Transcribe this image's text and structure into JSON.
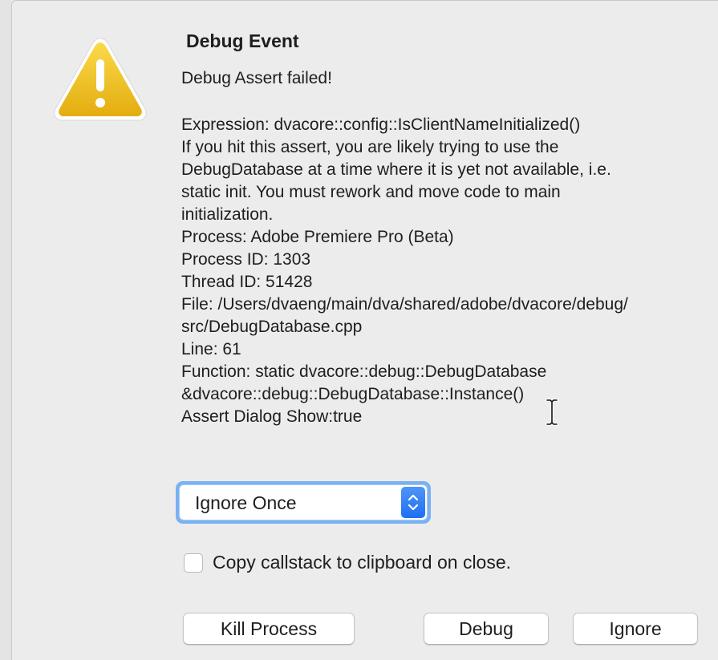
{
  "dialog": {
    "title": "Debug Event",
    "subtitle": "Debug Assert failed!",
    "icon": "warning-triangle-icon",
    "details": [
      "Expression: dvacore::config::IsClientNameInitialized()",
      "If you hit this assert, you are likely trying to use the",
      "DebugDatabase at a time where it is yet not available, i.e.",
      "static init. You must rework and move code to main",
      "initialization.",
      "Process: Adobe Premiere Pro (Beta)",
      "Process ID: 1303",
      "Thread ID: 51428",
      "File: /Users/dvaeng/main/dva/shared/adobe/dvacore/debug/",
      "src/DebugDatabase.cpp",
      "Line: 61",
      "Function: static dvacore::debug::DebugDatabase",
      "&dvacore::debug::DebugDatabase::Instance()",
      "Assert Dialog Show:true"
    ]
  },
  "action_select": {
    "selected": "Ignore Once"
  },
  "callstack_checkbox": {
    "label": "Copy callstack to clipboard on close.",
    "checked": false
  },
  "buttons": {
    "kill": "Kill Process",
    "debug": "Debug",
    "ignore": "Ignore"
  },
  "colors": {
    "accent": "#1f6ff2",
    "focus_ring": "#7ab1f3",
    "warning": "#f2c21a"
  }
}
